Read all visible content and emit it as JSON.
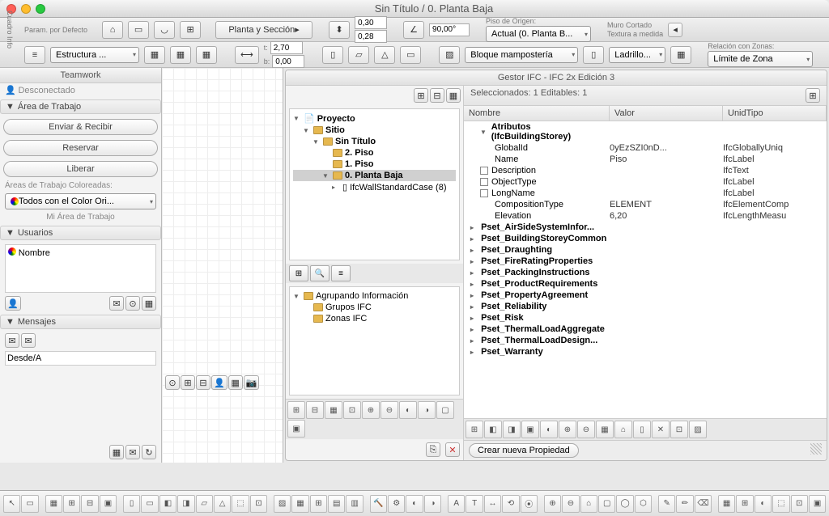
{
  "window": {
    "title": "Sin Título / 0. Planta Baja"
  },
  "side_panel_label": "Cuadro Info",
  "toolbar1": {
    "param_label": "Param. por Defecto",
    "section_btn": "Planta y Sección",
    "val1": "0,30",
    "val2": "0,28",
    "angle": "90,00°",
    "piso_label": "Piso de Origen:",
    "piso_value": "Actual (0. Planta B...",
    "muro_label": "Muro Cortado",
    "textura_label": "Textura a medida"
  },
  "toolbar2": {
    "structure": "Estructura ...",
    "t_label": "t:",
    "t_val": "2,70",
    "b_label": "b:",
    "b_val": "0,00",
    "bloque": "Bloque mampostería",
    "ladrillo": "Ladrillo...",
    "relacion_label": "Relación con Zonas:",
    "relacion_value": "Límite de Zona"
  },
  "teamwork": {
    "title": "Teamwork",
    "status": "Desconectado",
    "area": "Área de Trabajo",
    "btn_send": "Enviar & Recibir",
    "btn_reserve": "Reservar",
    "btn_release": "Liberar",
    "colored": "Áreas de Trabajo Coloreadas:",
    "color_sel": "Todos con el Color Ori...",
    "mi_area": "Mi Área de Trabajo",
    "usuarios": "Usuarios",
    "nombre": "Nombre",
    "mensajes": "Mensajes",
    "desde": "Desde/A"
  },
  "ifc": {
    "title": "Gestor IFC - IFC 2x Edición 3",
    "sel_label": "Seleccionados:  1    Editables:  1",
    "tree": {
      "proyecto": "Proyecto",
      "sitio": "Sitio",
      "sintitulo": "Sin Título",
      "piso2": "2. Piso",
      "piso1": "1. Piso",
      "planta0": "0. Planta Baja",
      "wall": "IfcWallStandardCase (8)"
    },
    "group": {
      "title": "Agrupando Información",
      "ifc": "Grupos IFC",
      "zonas": "Zonas IFC"
    },
    "cols": {
      "nombre": "Nombre",
      "valor": "Valor",
      "unid": "UnidTipo"
    },
    "attrs_header": "Atributos (IfcBuildingStorey)",
    "attrs": [
      {
        "name": "GlobalId",
        "val": "0yEzSZI0nD...",
        "unit": "IfcGloballyUniq"
      },
      {
        "name": "Name",
        "val": "Piso",
        "unit": "IfcLabel"
      },
      {
        "name": "Description",
        "val": "",
        "unit": "IfcText",
        "chk": true
      },
      {
        "name": "ObjectType",
        "val": "",
        "unit": "IfcLabel",
        "chk": true
      },
      {
        "name": "LongName",
        "val": "",
        "unit": "IfcLabel",
        "chk": true
      },
      {
        "name": "CompositionType",
        "val": "ELEMENT",
        "unit": "IfcElementComp"
      },
      {
        "name": "Elevation",
        "val": "6,20",
        "unit": "IfcLengthMeasu"
      }
    ],
    "psets": [
      "Pset_AirSideSystemInfor...",
      "Pset_BuildingStoreyCommon",
      "Pset_Draughting",
      "Pset_FireRatingProperties",
      "Pset_PackingInstructions",
      "Pset_ProductRequirements",
      "Pset_PropertyAgreement",
      "Pset_Reliability",
      "Pset_Risk",
      "Pset_ThermalLoadAggregate",
      "Pset_ThermalLoadDesign...",
      "Pset_Warranty"
    ],
    "new_prop": "Crear nueva Propiedad"
  }
}
